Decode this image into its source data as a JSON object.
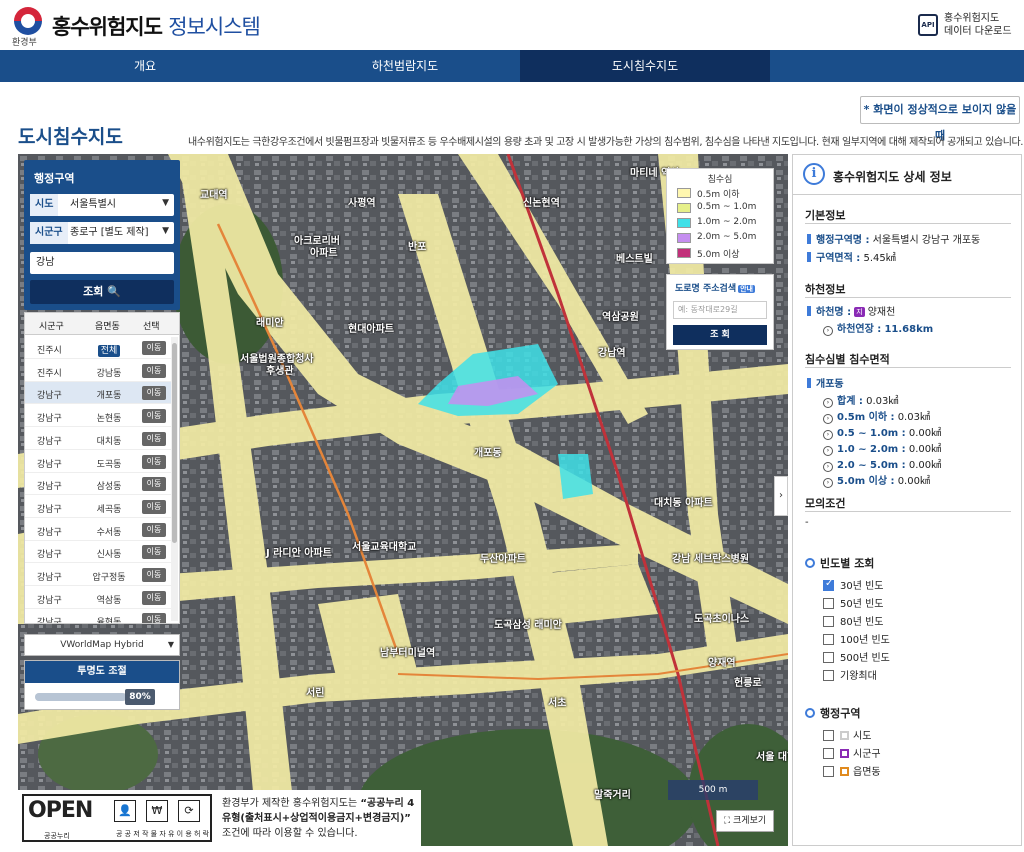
{
  "header": {
    "logo_sub": "환경부",
    "title_main": "홍수위험지도",
    "title_sub": "정보시스템",
    "api_icon": "API",
    "api_line1": "홍수위험지도",
    "api_line2": "데이터 다운로드"
  },
  "nav": {
    "items": [
      "개요",
      "하천범람지도",
      "도시침수지도"
    ],
    "active": "도시침수지도"
  },
  "notice_button": "* 화면이 정상적으로 보이지 않을때",
  "page": {
    "title": "도시침수지도",
    "description": "내수위험지도는 극한강우조건에서 빗물펌프장과 빗물저류조 등 우수배제시설의 용량 초과 및 고장 시 발생가능한 가상의 침수범위, 침수심을 나타낸 지도입니다. 현재 일부지역에 대해 제작되어 공개되고 있습니다."
  },
  "admin": {
    "title": "행정구역",
    "sido_label": "시도",
    "sido_value": "서울특별시",
    "sigungu_label": "시군구",
    "sigungu_value": "종로구 [별도 제작]",
    "search_value": "강남",
    "search_button": "조회 🔍"
  },
  "dong_table": {
    "headers": [
      "시군구",
      "읍면동",
      "선택"
    ],
    "rows": [
      {
        "sigungu": "진주시",
        "dong": "전체",
        "action": "이동"
      },
      {
        "sigungu": "진주시",
        "dong": "강남동",
        "action": "이동"
      },
      {
        "sigungu": "강남구",
        "dong": "개포동",
        "action": "이동"
      },
      {
        "sigungu": "강남구",
        "dong": "논현동",
        "action": "이동"
      },
      {
        "sigungu": "강남구",
        "dong": "대치동",
        "action": "이동"
      },
      {
        "sigungu": "강남구",
        "dong": "도곡동",
        "action": "이동"
      },
      {
        "sigungu": "강남구",
        "dong": "삼성동",
        "action": "이동"
      },
      {
        "sigungu": "강남구",
        "dong": "세곡동",
        "action": "이동"
      },
      {
        "sigungu": "강남구",
        "dong": "수서동",
        "action": "이동"
      },
      {
        "sigungu": "강남구",
        "dong": "신사동",
        "action": "이동"
      },
      {
        "sigungu": "강남구",
        "dong": "압구정동",
        "action": "이동"
      },
      {
        "sigungu": "강남구",
        "dong": "역삼동",
        "action": "이동"
      },
      {
        "sigungu": "강남구",
        "dong": "율현동",
        "action": "이동"
      }
    ]
  },
  "basemap": {
    "value": "VWorldMap Hybrid"
  },
  "opacity": {
    "title": "투명도 조절",
    "value_label": "80%",
    "value": 0.8
  },
  "legend": {
    "title": "침수심",
    "items": [
      {
        "label": "0.5m 이하",
        "color": "#fff7b0"
      },
      {
        "label": "0.5m ~ 1.0m",
        "color": "#e6f08a"
      },
      {
        "label": "1.0m ~ 2.0m",
        "color": "#3fe0e8"
      },
      {
        "label": "2.0m ~ 5.0m",
        "color": "#c58ef0"
      },
      {
        "label": "5.0m 이상",
        "color": "#c2307a"
      }
    ]
  },
  "road_search": {
    "title": "도로명 주소검색",
    "guide": "안내",
    "placeholder": "예: 동작대로29길",
    "button": "조 회"
  },
  "map_labels": {
    "a": "신논현역",
    "b": "사평역",
    "c": "아크로리버",
    "d": "반포",
    "e": "아파트",
    "f": "래미안",
    "g": "현대아파트",
    "h": "서울법원종합청사",
    "i": "후생관",
    "j": "베스트빌",
    "k": "역삼공원",
    "l": "강남역",
    "m": "개포동",
    "n": "서울교육대학교",
    "o": "두산아파트",
    "p": "J 라디안 아파트",
    "q": "강남 세브란스병원",
    "r": "도곡초이나스",
    "s": "양재역",
    "t": "남부터미널역",
    "u": "서초",
    "v": "서린",
    "w": "말죽거리",
    "x": "도곡삼성 래미안",
    "y": "마티네 역삼",
    "z": "교대역",
    "aa": "대치동 아파트",
    "ab": "헌릉로",
    "ac": "서울 대학교"
  },
  "scale_bar": "500 m",
  "fullscreen_button": "크게보기",
  "license": {
    "open": "OPEN",
    "kogl": "공공누리",
    "sub": "공 공 저 작 물   자 유 이 용 허 락",
    "icons": [
      "출처표시",
      "상업용금지",
      "변경금지"
    ],
    "text_pre": "환경부가 제작한 홍수위험지도는 ",
    "text_bold": "“공공누리 4유형(출처표시+상업적이용금지+변경금지)”",
    "text_post": " 조건에 따라 이용할 수 있습니다."
  },
  "info_panel": {
    "title": "홍수위험지도 상세 정보",
    "basic": {
      "title": "기본정보",
      "admin_label": "행정구역명 :",
      "admin_value": "서울특별시 강남구 개포동",
      "area_label": "구역면적 :",
      "area_value": "5.45㎢"
    },
    "river": {
      "title": "하천정보",
      "name_label": "하천명 :",
      "badge": "지",
      "name_value": "양재천",
      "length_label": "하천연장 :",
      "length_value": "11.68km"
    },
    "depth": {
      "title": "침수심별 침수면적",
      "dong": "개포동",
      "rows": [
        {
          "label": "합계 :",
          "value": "0.03㎢"
        },
        {
          "label": "0.5m 이하 :",
          "value": "0.03㎢"
        },
        {
          "label": "0.5 ~ 1.0m :",
          "value": "0.00㎢"
        },
        {
          "label": "1.0 ~ 2.0m :",
          "value": "0.00㎢"
        },
        {
          "label": "2.0 ~ 5.0m :",
          "value": "0.00㎢"
        },
        {
          "label": "5.0m 이상 :",
          "value": "0.00㎢"
        }
      ]
    },
    "sim": {
      "title": "모의조건",
      "value": "-"
    },
    "frequency": {
      "title": "빈도별 조회",
      "items": [
        {
          "label": "30년 빈도",
          "checked": true
        },
        {
          "label": "50년 빈도",
          "checked": false
        },
        {
          "label": "80년 빈도",
          "checked": false
        },
        {
          "label": "100년 빈도",
          "checked": false
        },
        {
          "label": "500년 빈도",
          "checked": false
        },
        {
          "label": "기왕최대",
          "checked": false
        }
      ]
    },
    "admin_zone": {
      "title": "행정구역",
      "items": [
        {
          "label": "시도",
          "color": "#cccccc"
        },
        {
          "label": "시군구",
          "color": "#8a2bb5"
        },
        {
          "label": "읍면동",
          "color": "#e08a1e"
        }
      ]
    }
  }
}
